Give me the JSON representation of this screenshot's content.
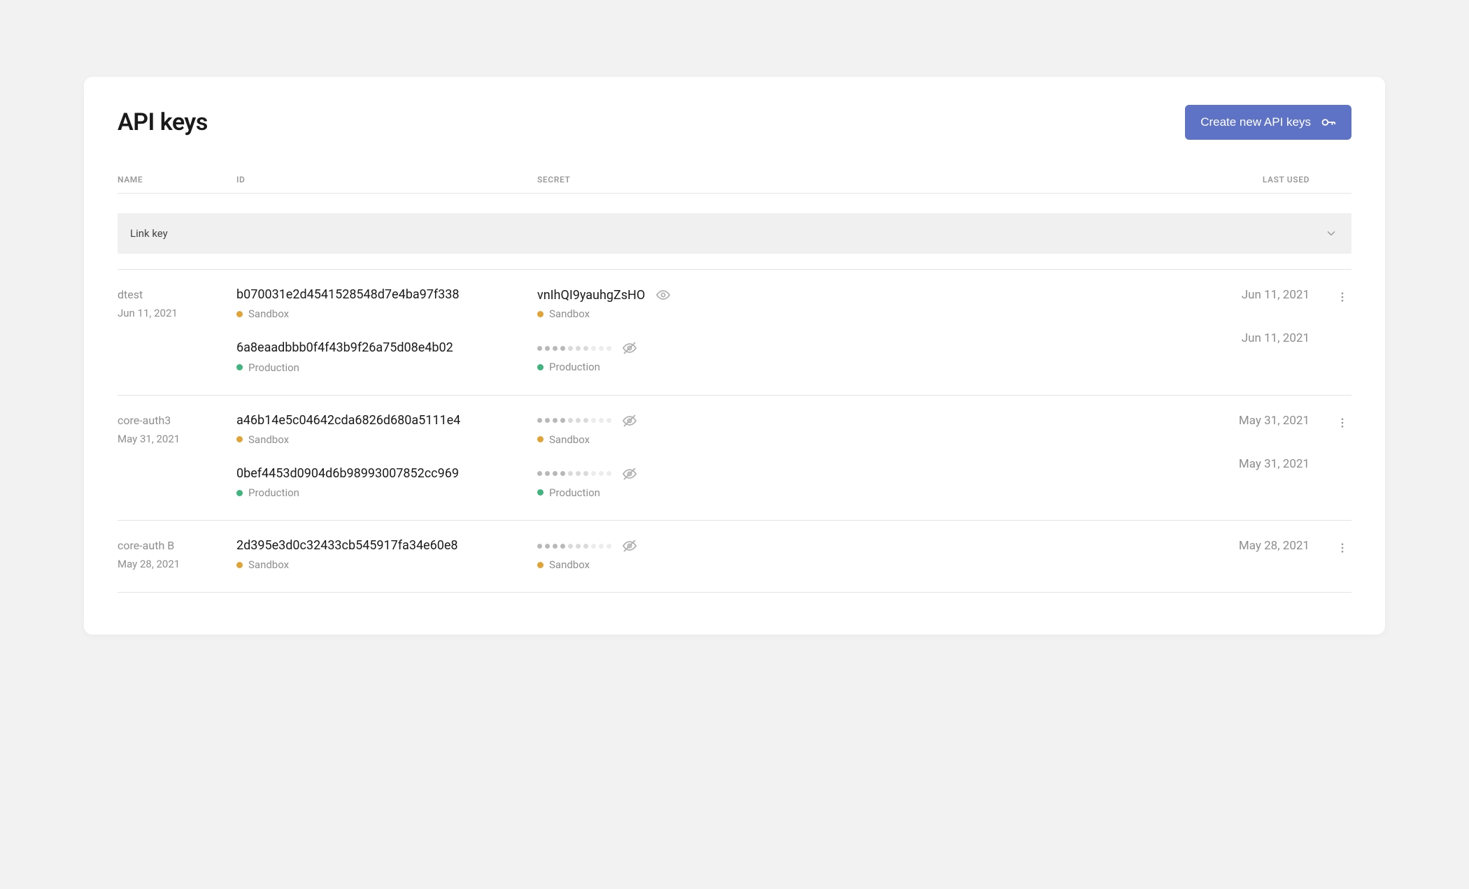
{
  "header": {
    "title": "API keys",
    "create_btn": "Create new API keys"
  },
  "columns": {
    "name": "NAME",
    "id": "ID",
    "secret": "SECRET",
    "last_used": "LAST USED"
  },
  "link_key_bar": {
    "label": "Link key"
  },
  "env_labels": {
    "sandbox": "Sandbox",
    "production": "Production"
  },
  "rows": [
    {
      "name": "dtest",
      "created": "Jun 11, 2021",
      "keys": [
        {
          "env": "sandbox",
          "id": "b070031e2d4541528548d7e4ba97f338",
          "secret_plain": "vnIhQI9yauhgZsHO",
          "secret_visible": true,
          "last_used": "Jun 11, 2021"
        },
        {
          "env": "production",
          "id": "6a8eaadbbb0f4f43b9f26a75d08e4b02",
          "secret_visible": false,
          "last_used": "Jun 11, 2021"
        }
      ]
    },
    {
      "name": "core-auth3",
      "created": "May 31, 2021",
      "keys": [
        {
          "env": "sandbox",
          "id": "a46b14e5c04642cda6826d680a5111e4",
          "secret_visible": false,
          "last_used": "May 31, 2021"
        },
        {
          "env": "production",
          "id": "0bef4453d0904d6b98993007852cc969",
          "secret_visible": false,
          "last_used": "May 31, 2021"
        }
      ]
    },
    {
      "name": "core-auth B",
      "created": "May 28, 2021",
      "keys": [
        {
          "env": "sandbox",
          "id": "2d395e3d0c32433cb545917fa34e60e8",
          "secret_visible": false,
          "last_used": "May 28, 2021"
        }
      ]
    }
  ]
}
